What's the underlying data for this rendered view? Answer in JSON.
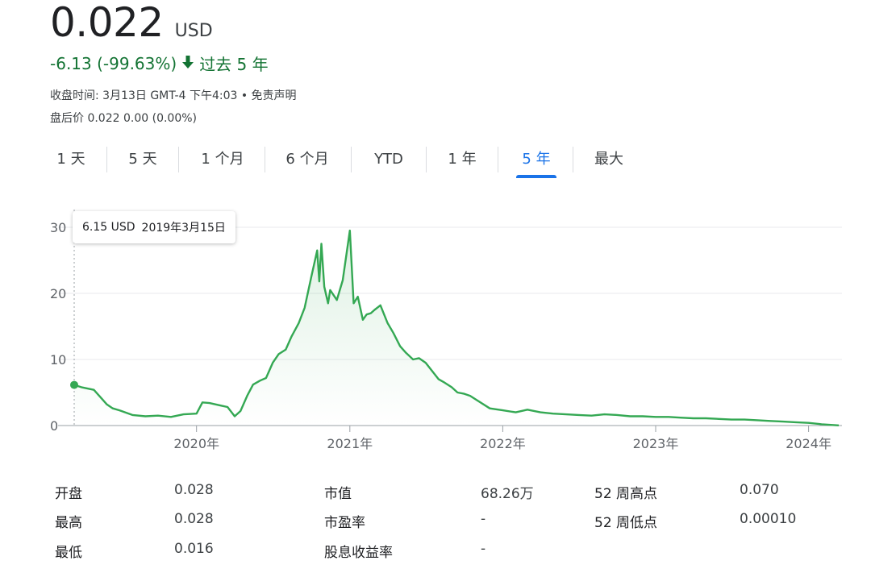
{
  "quote": {
    "price": "0.022",
    "currency": "USD",
    "change": "-6.13 (-99.63%)",
    "period": "过去 5 年",
    "close_time": "收盘时间: 3月13日 GMT-4 下午4:03 • 免责声明",
    "after_hours": "盘后价 0.022 0.00 (0.00%)"
  },
  "tabs": [
    {
      "label": "1 天"
    },
    {
      "label": "5 天"
    },
    {
      "label": "1 个月"
    },
    {
      "label": "6 个月"
    },
    {
      "label": "YTD"
    },
    {
      "label": "1 年"
    },
    {
      "label": "5 年",
      "active": true
    },
    {
      "label": "最大"
    }
  ],
  "tooltip": {
    "price": "6.15 USD",
    "date": "2019年3月15日"
  },
  "colors": {
    "positive": "#137333",
    "line": "#34a853",
    "accent": "#1a73e8"
  },
  "chart_data": {
    "type": "area",
    "x_tick_labels": [
      "2020年",
      "2021年",
      "2022年",
      "2023年",
      "2024年"
    ],
    "x_ticks": [
      "2020-01-01",
      "2021-01-01",
      "2022-01-01",
      "2023-01-01",
      "2024-01-01"
    ],
    "y_ticks": [
      0,
      10,
      20,
      30
    ],
    "xlim": [
      "2019-03-15",
      "2024-03-13"
    ],
    "ylim": [
      0,
      30
    ],
    "grid": true,
    "highlight_point": {
      "x": "2019-03-15",
      "y": 6.15
    },
    "x": [
      "2019-03-15",
      "2019-04-01",
      "2019-05-01",
      "2019-06-01",
      "2019-06-15",
      "2019-07-01",
      "2019-08-01",
      "2019-09-01",
      "2019-10-01",
      "2019-11-01",
      "2019-12-01",
      "2020-01-01",
      "2020-01-15",
      "2020-02-01",
      "2020-03-01",
      "2020-03-15",
      "2020-04-01",
      "2020-04-15",
      "2020-05-01",
      "2020-05-15",
      "2020-06-01",
      "2020-06-15",
      "2020-07-01",
      "2020-07-15",
      "2020-08-01",
      "2020-08-15",
      "2020-09-01",
      "2020-09-15",
      "2020-10-01",
      "2020-10-15",
      "2020-10-20",
      "2020-10-25",
      "2020-11-01",
      "2020-11-10",
      "2020-11-15",
      "2020-12-01",
      "2020-12-15",
      "2021-01-01",
      "2021-01-10",
      "2021-01-20",
      "2021-02-01",
      "2021-02-10",
      "2021-02-20",
      "2021-03-01",
      "2021-03-15",
      "2021-04-01",
      "2021-04-15",
      "2021-05-01",
      "2021-05-15",
      "2021-06-01",
      "2021-06-15",
      "2021-07-01",
      "2021-08-01",
      "2021-08-15",
      "2021-09-01",
      "2021-09-15",
      "2021-10-01",
      "2021-10-15",
      "2021-11-01",
      "2021-12-01",
      "2022-01-01",
      "2022-02-01",
      "2022-03-01",
      "2022-04-01",
      "2022-05-01",
      "2022-06-01",
      "2022-07-01",
      "2022-08-01",
      "2022-09-01",
      "2022-10-01",
      "2022-11-01",
      "2022-12-01",
      "2023-01-01",
      "2023-02-01",
      "2023-03-01",
      "2023-04-01",
      "2023-05-01",
      "2023-06-01",
      "2023-07-01",
      "2023-08-01",
      "2023-09-01",
      "2023-10-01",
      "2023-11-01",
      "2023-12-01",
      "2024-01-01",
      "2024-02-01",
      "2024-03-13"
    ],
    "values": [
      6.15,
      5.8,
      5.4,
      3.2,
      2.6,
      2.3,
      1.6,
      1.4,
      1.5,
      1.3,
      1.7,
      1.8,
      3.5,
      3.4,
      3.0,
      2.8,
      1.4,
      2.2,
      4.5,
      6.2,
      6.8,
      7.2,
      9.5,
      10.8,
      11.5,
      13.5,
      15.5,
      17.8,
      22.5,
      26.5,
      21.8,
      27.5,
      21.0,
      18.5,
      20.5,
      19.0,
      22.0,
      29.5,
      18.5,
      19.5,
      16.0,
      16.8,
      17.0,
      17.5,
      18.2,
      15.5,
      14.0,
      12.0,
      11.0,
      10.0,
      10.2,
      9.5,
      7.0,
      6.5,
      5.8,
      5.0,
      4.8,
      4.5,
      3.8,
      2.6,
      2.3,
      2.0,
      2.4,
      2.0,
      1.8,
      1.7,
      1.6,
      1.5,
      1.7,
      1.6,
      1.4,
      1.4,
      1.3,
      1.3,
      1.2,
      1.1,
      1.1,
      1.0,
      0.9,
      0.9,
      0.8,
      0.7,
      0.6,
      0.5,
      0.4,
      0.2,
      0.022
    ]
  },
  "stats": [
    {
      "label": "开盘",
      "value": "0.028"
    },
    {
      "label": "最高",
      "value": "0.028"
    },
    {
      "label": "最低",
      "value": "0.016"
    },
    {
      "label": "市值",
      "value": "68.26万"
    },
    {
      "label": "市盈率",
      "value": "-"
    },
    {
      "label": "股息收益率",
      "value": "-"
    },
    {
      "label": "52 周高点",
      "value": "0.070"
    },
    {
      "label": "52 周低点",
      "value": "0.00010"
    }
  ]
}
